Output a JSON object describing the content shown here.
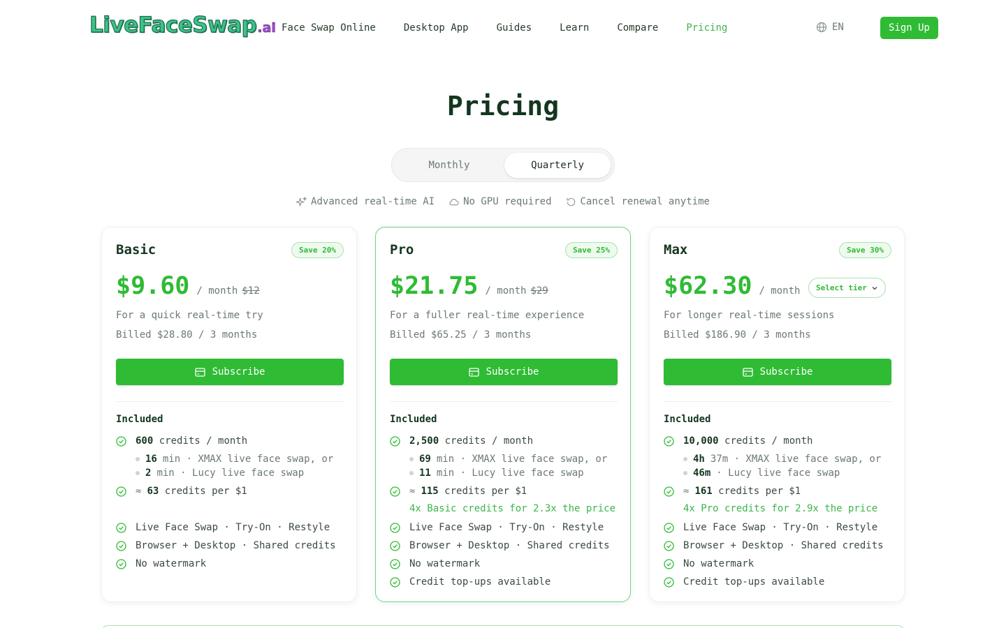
{
  "header": {
    "logo_main": "LiveFaceSwap",
    "logo_suffix": ".ai",
    "nav": [
      "Face Swap Online",
      "Desktop App",
      "Guides",
      "Learn",
      "Compare",
      "Pricing"
    ],
    "active_nav": "Pricing",
    "language": "EN",
    "signup_label": "Sign Up"
  },
  "page_title": "Pricing",
  "billing_toggle": {
    "monthly": "Monthly",
    "quarterly": "Quarterly",
    "selected": "Quarterly"
  },
  "perks": [
    "Advanced real-time AI",
    "No GPU required",
    "Cancel renewal anytime"
  ],
  "colors": {
    "accent": "#2fbb34",
    "title": "#14361f",
    "muted": "#6b7a70"
  },
  "plans": [
    {
      "name": "Basic",
      "save": "Save 20%",
      "price": "$9.60",
      "per": "/ month",
      "old_price": "$12",
      "desc": "For a quick real-time try",
      "billed": "Billed $28.80 / 3 months",
      "subscribe": "Subscribe",
      "included": "Included",
      "credits_num": "600",
      "credits_text": "credits / month",
      "sub1_num": "16",
      "sub1_text": "min · XMAX live face swap, or",
      "sub2_num": "2",
      "sub2_text": "min · Lucy live face swap",
      "approx": "≈",
      "per_dollar_num": "63",
      "per_dollar_text": "credits per $1",
      "features": [
        "Live Face Swap · Try-On · Restyle",
        "Browser + Desktop · Shared credits",
        "No watermark"
      ]
    },
    {
      "name": "Pro",
      "save": "Save 25%",
      "price": "$21.75",
      "per": "/ month",
      "old_price": "$29",
      "desc": "For a fuller real-time experience",
      "billed": "Billed $65.25 / 3 months",
      "subscribe": "Subscribe",
      "included": "Included",
      "credits_num": "2,500",
      "credits_text": "credits / month",
      "sub1_num": "69",
      "sub1_text": "min · XMAX live face swap, or",
      "sub2_num": "11",
      "sub2_text": "min · Lucy live face swap",
      "approx": "≈",
      "per_dollar_num": "115",
      "per_dollar_text": "credits per $1",
      "note": "4x Basic credits for 2.3x the price",
      "features": [
        "Live Face Swap · Try-On · Restyle",
        "Browser + Desktop · Shared credits",
        "No watermark",
        "Credit top-ups available"
      ]
    },
    {
      "name": "Max",
      "save": "Save 30%",
      "price": "$62.30",
      "per": "/ month",
      "tier_select": "Select tier",
      "desc": "For longer real-time sessions",
      "billed": "Billed $186.90 / 3 months",
      "subscribe": "Subscribe",
      "included": "Included",
      "credits_num": "10,000",
      "credits_text": "credits / month",
      "sub1_num": "4h",
      "sub1_text": "37m · XMAX live face swap, or",
      "sub2_num": "46m",
      "sub2_text": "· Lucy live face swap",
      "approx": "≈",
      "per_dollar_num": "161",
      "per_dollar_text": "credits per $1",
      "note": "4x Pro credits for 2.9x the price",
      "features": [
        "Live Face Swap · Try-On · Restyle",
        "Browser + Desktop · Shared credits",
        "No watermark",
        "Credit top-ups available"
      ]
    }
  ]
}
